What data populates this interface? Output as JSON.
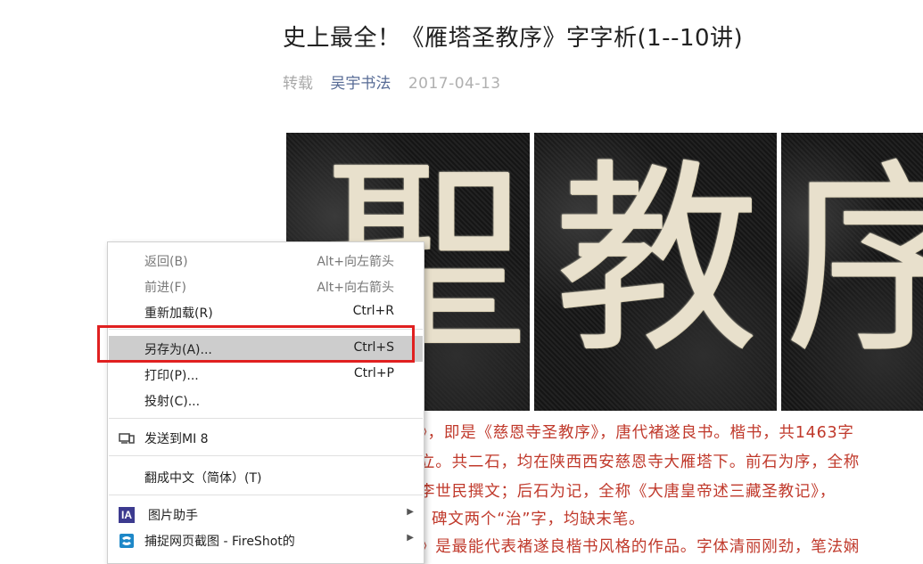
{
  "article": {
    "title": "史上最全！《雁塔圣教序》字字析(1--10讲)",
    "tag": "转载",
    "author": "吴宇书法",
    "date": "2017-04-13"
  },
  "image_tiles": [
    {
      "char": "聖"
    },
    {
      "char": "教"
    },
    {
      "char": "序"
    }
  ],
  "body_lines": [
    "》，即是《慈恩寺圣教序》，唐代褚遂良书。楷书，共1463字",
    "立。共二石，均在陕西西安慈恩寺大雁塔下。前石为序，全称",
    "李世民撰文；后石为记，全称《大唐皇帝述三藏圣教记》，",
    "碑文两个“治”字，均缺末笔。",
    "》是最能代表褚遂良楷书风格的作品。字体清丽刚劲，笔法娴"
  ],
  "context_menu": {
    "back": {
      "label": "返回(B)",
      "shortcut": "Alt+向左箭头"
    },
    "forward": {
      "label": "前进(F)",
      "shortcut": "Alt+向右箭头"
    },
    "reload": {
      "label": "重新加载(R)",
      "shortcut": "Ctrl+R"
    },
    "save_as": {
      "label": "另存为(A)...",
      "shortcut": "Ctrl+S"
    },
    "print": {
      "label": "打印(P)...",
      "shortcut": "Ctrl+P"
    },
    "cast": {
      "label": "投射(C)..."
    },
    "send_to": {
      "label": "发送到MI 8",
      "icon": "devices-icon"
    },
    "translate": {
      "label": "翻成中文（简体）(T)"
    },
    "image_helper": {
      "label": "图片助手",
      "icon": "ia-icon",
      "icon_text": "IA"
    },
    "fireshot": {
      "label": "捕捉网页截图 - FireShot的",
      "icon": "fireshot-icon"
    }
  },
  "colors": {
    "accent_link": "#576b95",
    "body_red": "#c0392b",
    "highlight_border": "#e02020"
  }
}
